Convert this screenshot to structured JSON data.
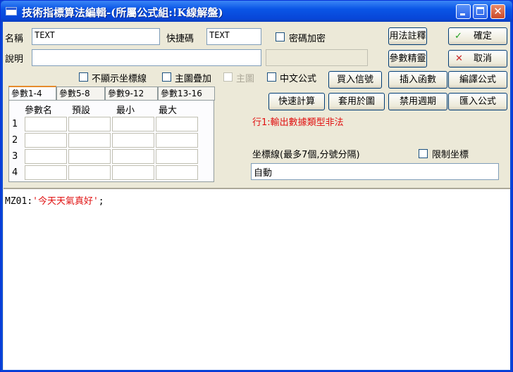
{
  "window": {
    "title": "技術指標算法編輯-(所屬公式組:!K線解盤)"
  },
  "form": {
    "name_label": "名稱",
    "name_value": "TEXT",
    "hotkey_label": "快捷碼",
    "hotkey_value": "TEXT",
    "password_label": "密碼加密",
    "desc_label": "說明",
    "desc_value": ""
  },
  "options": {
    "hide_axis": "不顯示坐標線",
    "main_overlay": "主圖疊加",
    "main_chart": "主圖",
    "chinese_formula": "中文公式"
  },
  "buttons": {
    "usage_note": "用法註釋",
    "ok": "確定",
    "param_wizard": "參數精靈",
    "cancel": "取消",
    "import_signal": "買入信號",
    "insert_func": "插入函數",
    "compile": "編譯公式",
    "quick_calc": "快速計算",
    "apply_chart": "套用於圖",
    "disable_period": "禁用週期",
    "import_formula": "匯入公式"
  },
  "tabs": [
    "參數1-4",
    "參數5-8",
    "參數9-12",
    "參數13-16"
  ],
  "params": {
    "headers": [
      "參數名",
      "預設",
      "最小",
      "最大"
    ],
    "rows": [
      "1",
      "2",
      "3",
      "4"
    ]
  },
  "status": {
    "error": "行1:輸出數據類型非法"
  },
  "axis": {
    "label": "坐標線(最多7個,分號分隔)",
    "limit_label": "限制坐標",
    "value": "自動"
  },
  "code": {
    "var": "MZ01",
    "sep": ":",
    "string": "'今天天氣真好'",
    "end": ";"
  }
}
